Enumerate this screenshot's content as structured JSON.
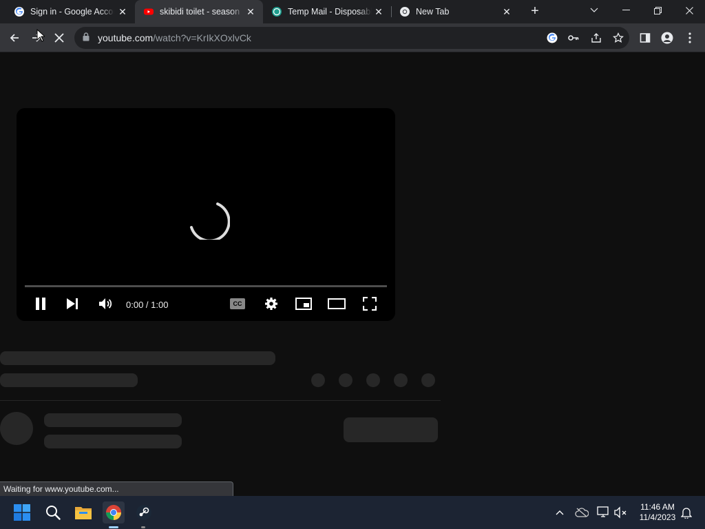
{
  "browser": {
    "tabs": [
      {
        "title": "Sign in - Google Accounts",
        "icon": "google-g-icon",
        "active": false
      },
      {
        "title": "skibidi toilet - season",
        "icon": "youtube-icon",
        "active": true
      },
      {
        "title": "Temp Mail - Disposable",
        "icon": "tempmail-icon",
        "active": false
      },
      {
        "title": "New Tab",
        "icon": "chrome-icon",
        "active": false
      }
    ],
    "close_glyph": "✕",
    "newtab_glyph": "+",
    "url_host": "youtube.com",
    "url_path": "/watch?v=KrIkXOxlvCk",
    "status_text": "Waiting for www.youtube.com..."
  },
  "player": {
    "time": "0:00 / 1:00",
    "cc_label": "CC"
  },
  "taskbar": {
    "time": "11:46 AM",
    "date": "11/4/2023"
  },
  "colors": {
    "page_bg": "#0f0f0f",
    "skeleton": "#272727",
    "tabstrip": "#1f2023",
    "toolbar": "#35363a",
    "taskbar": "#1c2433"
  }
}
